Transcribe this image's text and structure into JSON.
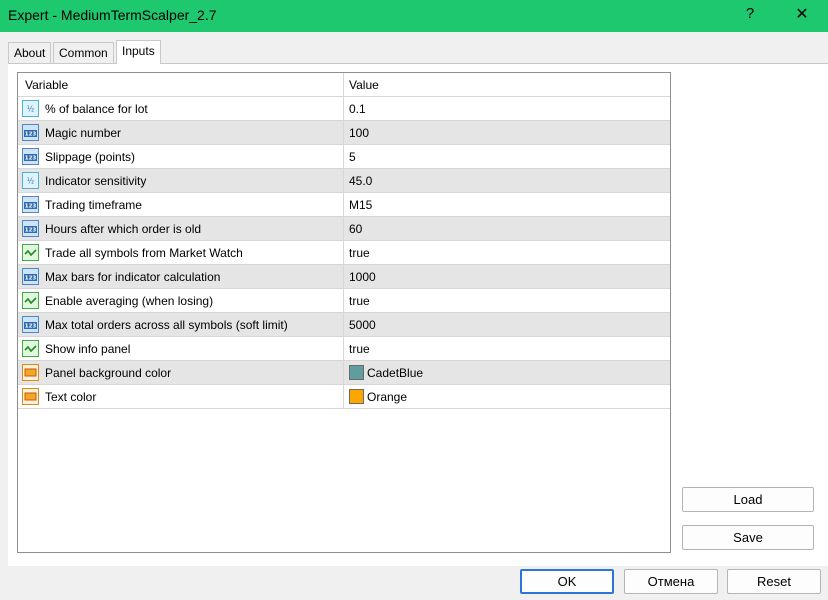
{
  "window": {
    "title": "Expert - MediumTermScalper_2.7",
    "help_glyph": "?",
    "close_glyph": "✕"
  },
  "tabs": [
    {
      "label": "About"
    },
    {
      "label": "Common"
    },
    {
      "label": "Inputs",
      "active": true
    }
  ],
  "grid": {
    "headers": {
      "variable": "Variable",
      "value": "Value"
    },
    "rows": [
      {
        "icon": "half-icon",
        "name": "% of balance for lot",
        "value": "0.1"
      },
      {
        "icon": "number-123-icon",
        "name": "Magic number",
        "value": "100"
      },
      {
        "icon": "number-123-icon",
        "name": "Slippage (points)",
        "value": "5"
      },
      {
        "icon": "half-icon",
        "name": "Indicator sensitivity",
        "value": "45.0"
      },
      {
        "icon": "number-123-icon",
        "name": "Trading timeframe",
        "value": "M15"
      },
      {
        "icon": "number-123-icon",
        "name": "Hours after which order is old",
        "value": "60"
      },
      {
        "icon": "bool-icon",
        "name": "Trade all symbols from Market Watch",
        "value": "true"
      },
      {
        "icon": "number-123-icon",
        "name": "Max bars for indicator calculation",
        "value": "1000"
      },
      {
        "icon": "bool-icon",
        "name": "Enable averaging (when losing)",
        "value": "true"
      },
      {
        "icon": "number-123-icon",
        "name": "Max total orders across all symbols (soft limit)",
        "value": "5000"
      },
      {
        "icon": "bool-icon",
        "name": "Show info panel",
        "value": "true"
      },
      {
        "icon": "color-icon",
        "name": "Panel background color",
        "value": "CadetBlue",
        "swatch": "#5f9ea0"
      },
      {
        "icon": "color-icon",
        "name": "Text color",
        "value": "Orange",
        "swatch": "#ffa500"
      }
    ]
  },
  "side_buttons": {
    "load": "Load",
    "save": "Save"
  },
  "footer_buttons": {
    "ok": "OK",
    "cancel": "Отмена",
    "reset": "Reset"
  },
  "colors": {
    "title_bar": "#1ec86e",
    "row_alt": "#e5e5e5",
    "default_button_border": "#2b74d8"
  }
}
